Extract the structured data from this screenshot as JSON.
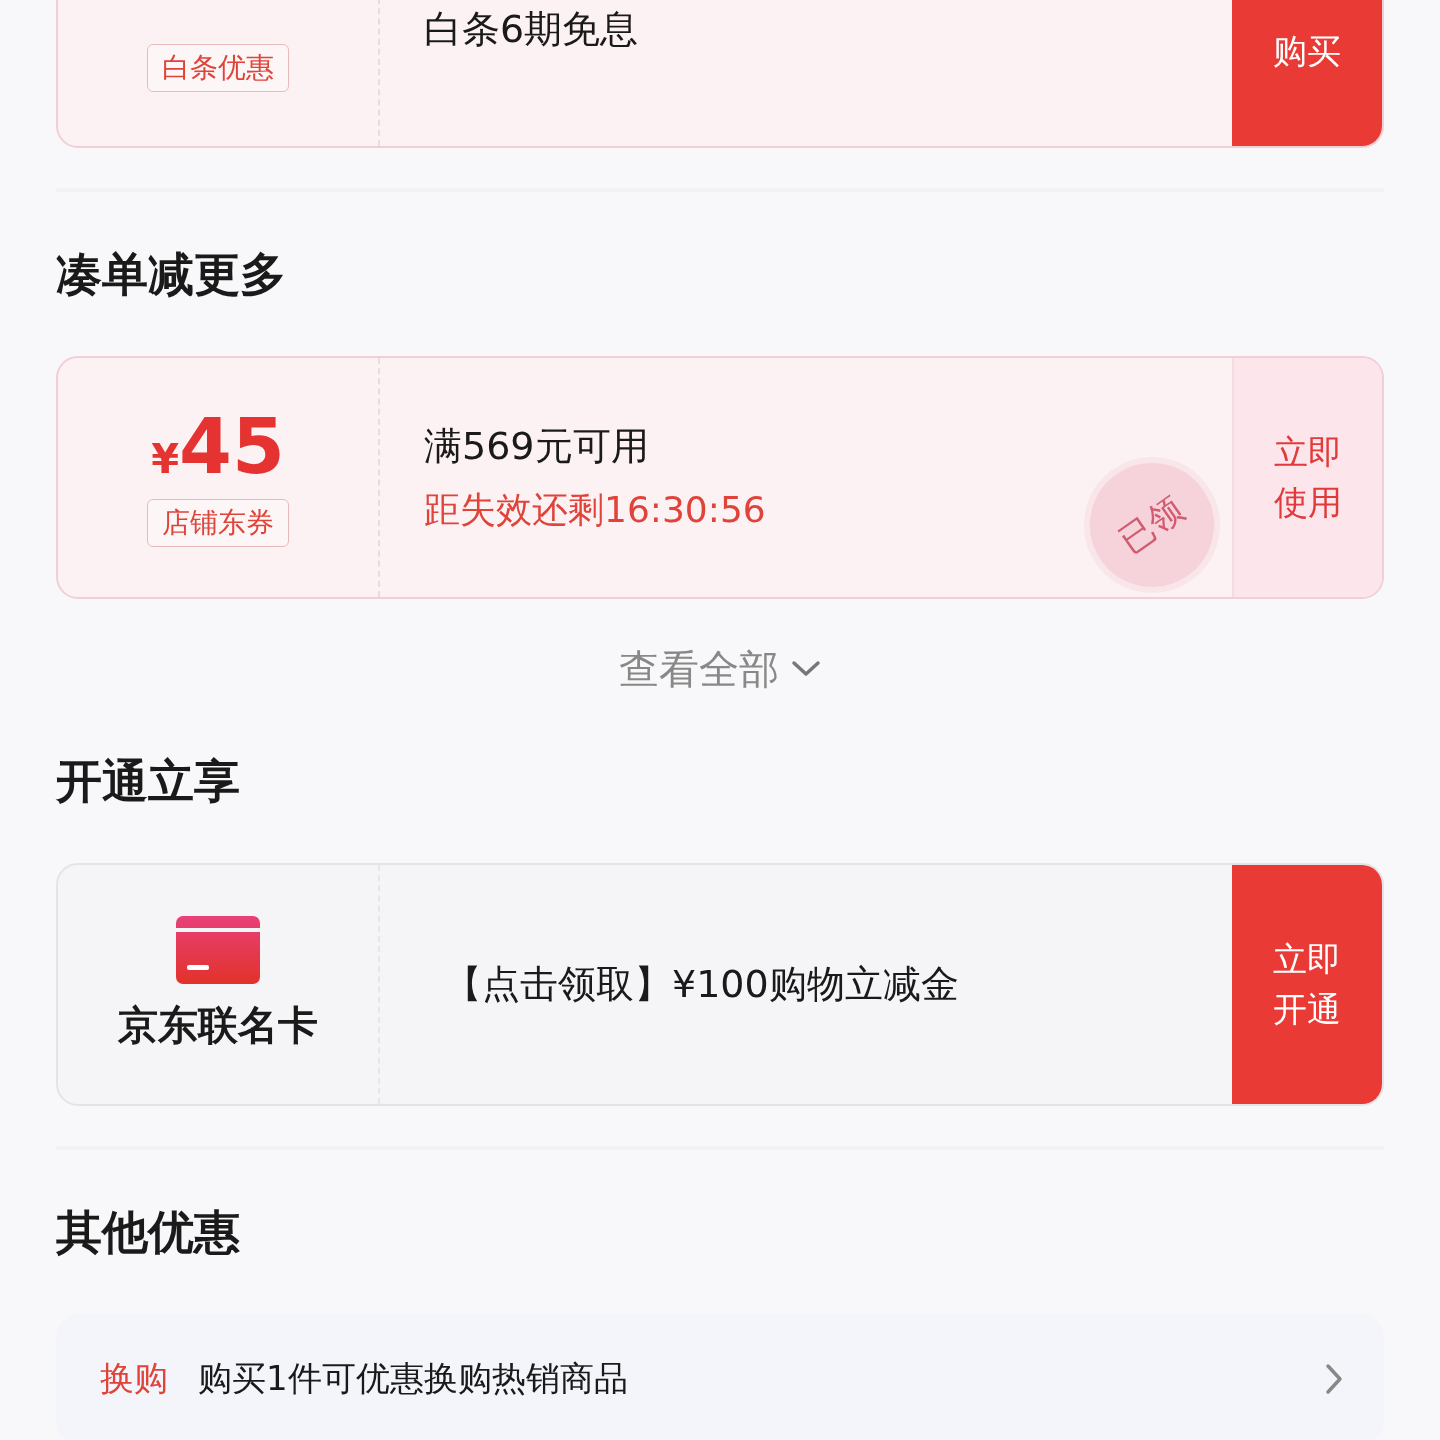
{
  "cards_top": [
    {
      "kind": "installment",
      "badge": "白条优惠",
      "title": "白条6期免息",
      "button": "购买"
    }
  ],
  "sections": [
    {
      "heading": "凑单减更多",
      "cards": [
        {
          "kind": "coupon",
          "currency": "¥",
          "amount": "45",
          "badge": "店铺东券",
          "condition": "满569元可用",
          "countdown": "距失效还剩16:30:56",
          "button": "立即使用",
          "claimed": true,
          "stamp": "已领"
        }
      ],
      "view_all": "查看全部"
    },
    {
      "heading": "开通立享",
      "cards": [
        {
          "kind": "card_offer",
          "name": "京东联名卡",
          "offer": "【点击领取】¥100购物立减金",
          "button": "立即开通"
        }
      ]
    },
    {
      "heading": "其他优惠",
      "rows": [
        {
          "tag": "换购",
          "text": "购买1件可优惠换购热销商品"
        }
      ]
    }
  ]
}
